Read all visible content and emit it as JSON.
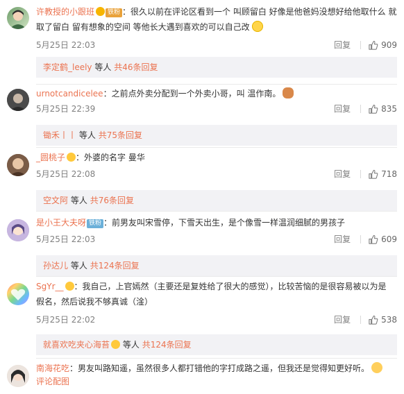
{
  "comments": [
    {
      "username": "许教授的小跟班",
      "fan_badge": "铁粉",
      "text": "：很久以前在评论区看到一个 叫顾留白 好像是他爸妈没想好给他取什么 就取了留白 留有想象的空间 等他长大遇到喜欢的可以自己改",
      "time": "5月25日 22:03",
      "reply_label": "回复",
      "likes": "909",
      "sub": {
        "user": "李定鹤_leely",
        "mid": "等人",
        "count_link": "共46条回复"
      }
    },
    {
      "username": "urnotcandicelee",
      "text": "：之前点外卖分配到一个外卖小哥，叫 温作南。",
      "time": "5月25日 22:39",
      "reply_label": "回复",
      "likes": "835",
      "sub": {
        "user": "锄禾丨丨",
        "mid": "等人",
        "count_link": "共75条回复"
      }
    },
    {
      "username": "_圆桃子",
      "text": "：外婆的名字 曼华",
      "time": "5月25日 22:08",
      "reply_label": "回复",
      "likes": "718",
      "sub": {
        "user": "空文阿",
        "mid": "等人",
        "count_link": "共76条回复"
      }
    },
    {
      "username": "是小王大夫呀",
      "fan_badge": "铁粉",
      "text": "：前男友叫宋雪停，下雪天出生，是个像雪一样温润细腻的男孩子",
      "time": "5月25日 22:03",
      "reply_label": "回复",
      "likes": "609",
      "sub": {
        "user": "孙达儿",
        "mid": "等人",
        "count_link": "共124条回复"
      }
    },
    {
      "username": "SgYr__",
      "text_line1": "：我自己，上官嫣然（主要还是复姓给了很大的感觉），比较苦恼的是很容易被以为是",
      "text_line2": "假名，然后说我不够真诚（淦）",
      "time": "5月25日 22:02",
      "reply_label": "回复",
      "likes": "538",
      "sub": {
        "user": "就喜欢吃夹心海苔",
        "mid": "等人",
        "count_link": "共124条回复"
      }
    },
    {
      "username": "南海花吃",
      "text": "：男友叫路知遥，虽然很多人都打错他的字打成路之遥，但我还是觉得知更好听。",
      "picture_link": "评论配图"
    }
  ],
  "colors": {
    "accent": "#eb7350",
    "meta": "#808080",
    "subreply_bg": "#f2f2f5"
  },
  "icons": {
    "like": "thumb-up-icon",
    "badge": "member-badge-icon"
  }
}
